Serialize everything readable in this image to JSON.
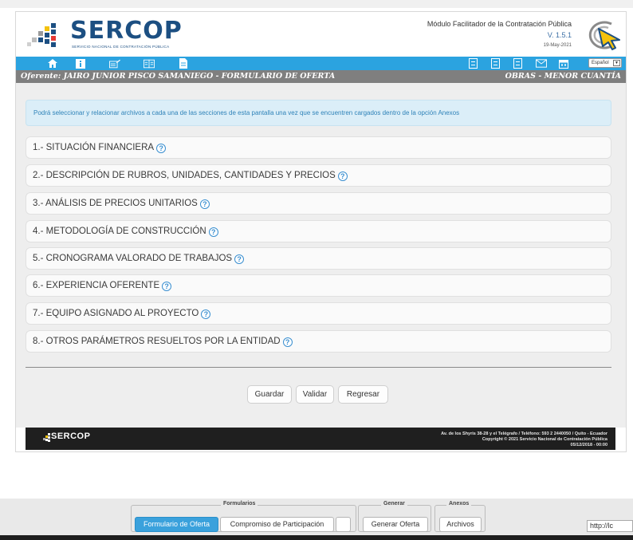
{
  "header": {
    "brand_name": "SERCOP",
    "brand_subtitle": "SERVICIO NACIONAL DE CONTRATACIÓN PÚBLICA",
    "module_title": "Módulo Facilitador de la Contratación Pública",
    "version": "V. 1.5.1",
    "date": "19-May-2021"
  },
  "toolbar": {
    "language_select": "Español"
  },
  "bidbar": {
    "left": "Oferente: JAIRO JUNIOR PISCO SAMANIEGO - FORMULARIO DE OFERTA",
    "right": "OBRAS - MENOR CUANTÍA"
  },
  "info": {
    "text": "Podrá seleccionar y relacionar archivos a cada una de las secciones de esta pantalla una vez que se encuentren cargados dentro de la opción Anexos"
  },
  "sections": [
    {
      "label": "1.- SITUACIÓN FINANCIERA"
    },
    {
      "label": "2.- DESCRIPCIÓN DE RUBROS, UNIDADES, CANTIDADES Y PRECIOS"
    },
    {
      "label": "3.- ANÁLISIS DE PRECIOS UNITARIOS"
    },
    {
      "label": "4.- METODOLOGÍA DE CONSTRUCCIÓN"
    },
    {
      "label": "5.- CRONOGRAMA VALORADO DE TRABAJOS"
    },
    {
      "label": "6.- EXPERIENCIA OFERENTE"
    },
    {
      "label": "7.- EQUIPO ASIGNADO AL PROYECTO"
    },
    {
      "label": "8.- OTROS PARÁMETROS RESUELTOS POR LA ENTIDAD"
    }
  ],
  "actions": {
    "save": "Guardar",
    "validate": "Validar",
    "back": "Regresar"
  },
  "footer": {
    "brand": "SERCOP",
    "address": "Av. de los Shyris 38-28 y el Telégrafo / Teléfono: 593 2 2440050 / Quito - Ecuador",
    "copyright": "Copyright © 2021 Servicio Nacional de Contratación Pública",
    "build": "05/12/2018 - 00:00"
  },
  "bottom_nav": {
    "groups": {
      "forms": "Formularios",
      "generate": "Generar",
      "annexes": "Anexos"
    },
    "buttons": {
      "offer_form": "Formulario de Oferta",
      "participation": "Compromiso de Participación",
      "generate_offer": "Generar Oferta",
      "files": "Archivos"
    },
    "url": "http://lc"
  },
  "colors": {
    "toolbar": "#2ba3e0",
    "bidbar": "#7f7f7f",
    "brand": "#1c4f82",
    "active_tab": "#3aa1dc"
  }
}
